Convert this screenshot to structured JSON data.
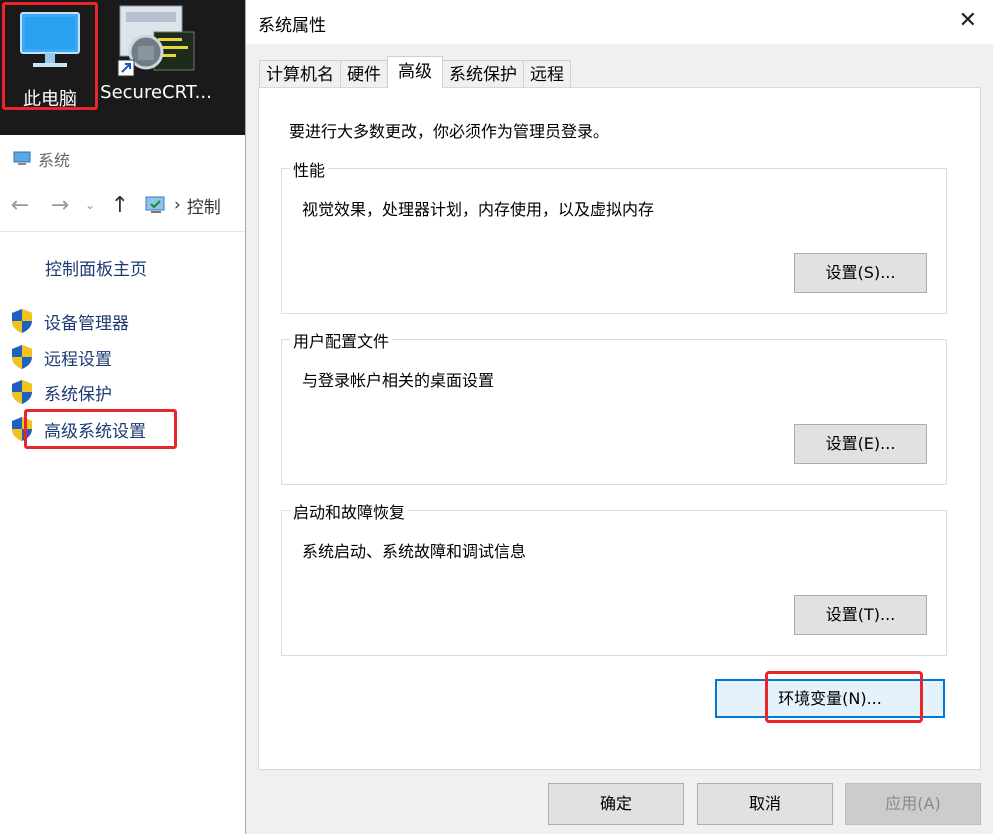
{
  "desktop": {
    "icons": [
      {
        "label": "此电脑",
        "icon": "monitor-icon"
      },
      {
        "label": "SecureCRT...",
        "icon": "securecrt-icon"
      }
    ]
  },
  "explorer": {
    "title": "系统",
    "breadcrumb": "控制",
    "control_panel_home": "控制面板主页",
    "side_links": [
      "设备管理器",
      "远程设置",
      "系统保护",
      "高级系统设置"
    ]
  },
  "dialog": {
    "title": "系统属性",
    "tabs": [
      "计算机名",
      "硬件",
      "高级",
      "系统保护",
      "远程"
    ],
    "active_tab": "高级",
    "intro": "要进行大多数更改，你必须作为管理员登录。",
    "groups": [
      {
        "title": "性能",
        "desc": "视觉效果，处理器计划，内存使用，以及虚拟内存",
        "button": "设置(S)..."
      },
      {
        "title": "用户配置文件",
        "desc": "与登录帐户相关的桌面设置",
        "button": "设置(E)..."
      },
      {
        "title": "启动和故障恢复",
        "desc": "系统启动、系统故障和调试信息",
        "button": "设置(T)..."
      }
    ],
    "env_button": "环境变量(N)...",
    "ok_button": "确定",
    "cancel_button": "取消",
    "apply_button": "应用(A)"
  },
  "colors": {
    "highlight_red": "#e8262b",
    "link_blue": "#1d3b72",
    "focus_blue": "#0078d7"
  }
}
